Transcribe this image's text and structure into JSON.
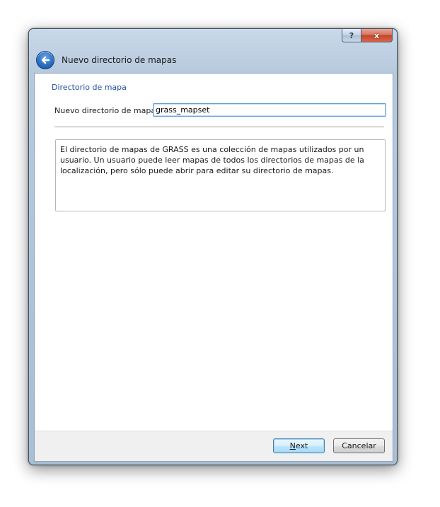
{
  "window": {
    "help_label": "?",
    "close_label": "x"
  },
  "wizard": {
    "title": "Nuevo directorio de mapas"
  },
  "page": {
    "section_title": "Directorio de mapa",
    "field_label": "Nuevo directorio de mapas:",
    "mapset_value": "grass_mapset",
    "description": "El directorio de mapas de GRASS es una colección de mapas utilizados por un usuario. Un usuario puede leer mapas de todos los directorios de mapas de la localización, pero sólo puede abrir para editar su directorio de mapas."
  },
  "footer": {
    "next_accel": "N",
    "next_rest": "ext",
    "cancel_label": "Cancelar"
  },
  "icons": {
    "back": "back-arrow-icon",
    "help": "help-icon",
    "close": "close-icon"
  },
  "colors": {
    "section_title": "#1e4fa0",
    "focus_border": "#5b9bd5",
    "close_red": "#c2452a"
  }
}
